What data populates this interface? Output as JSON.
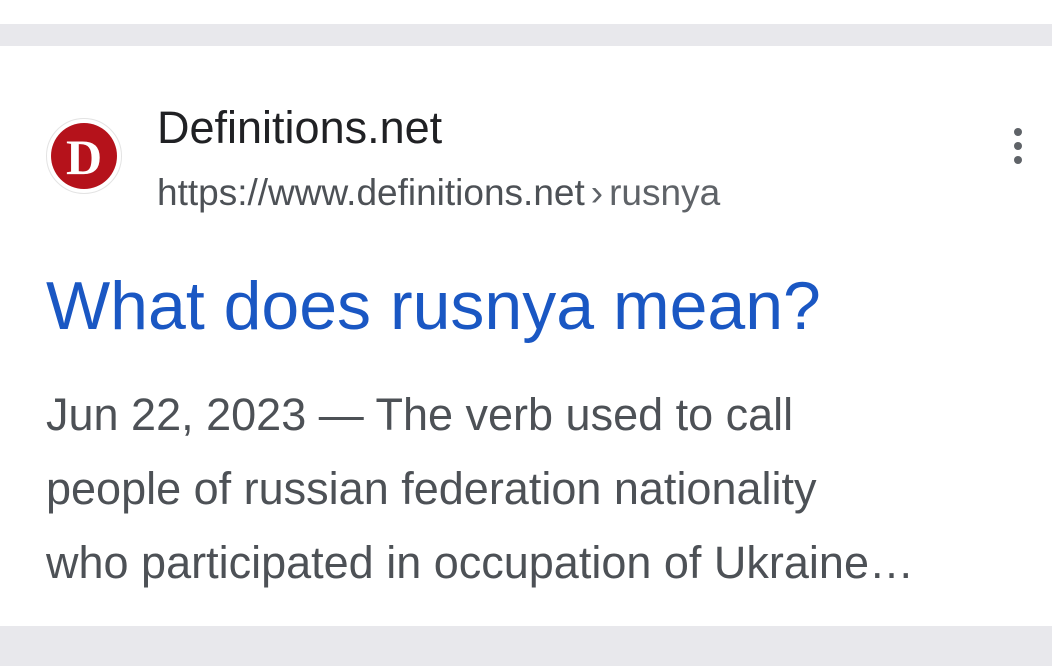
{
  "result": {
    "favicon_letter": "D",
    "favicon_icon": "definitions-logo-icon",
    "site_name": "Definitions.net",
    "url": "https://www.definitions.net",
    "url_separator": "›",
    "url_path": "rusnya",
    "more_icon": "more-vert-icon",
    "title": "What does rusnya mean?",
    "snippet": {
      "date": "Jun 22, 2023",
      "dash": "—",
      "line1_text": "The verb used to call",
      "line2": "people of russian federation nationality",
      "line3": "who participated in occupation of Ukraine…"
    }
  },
  "colors": {
    "title_link": "#1a57c3",
    "favicon_red": "#b5121b",
    "divider": "#e8e8ec",
    "snippet_text": "#4d5156"
  }
}
